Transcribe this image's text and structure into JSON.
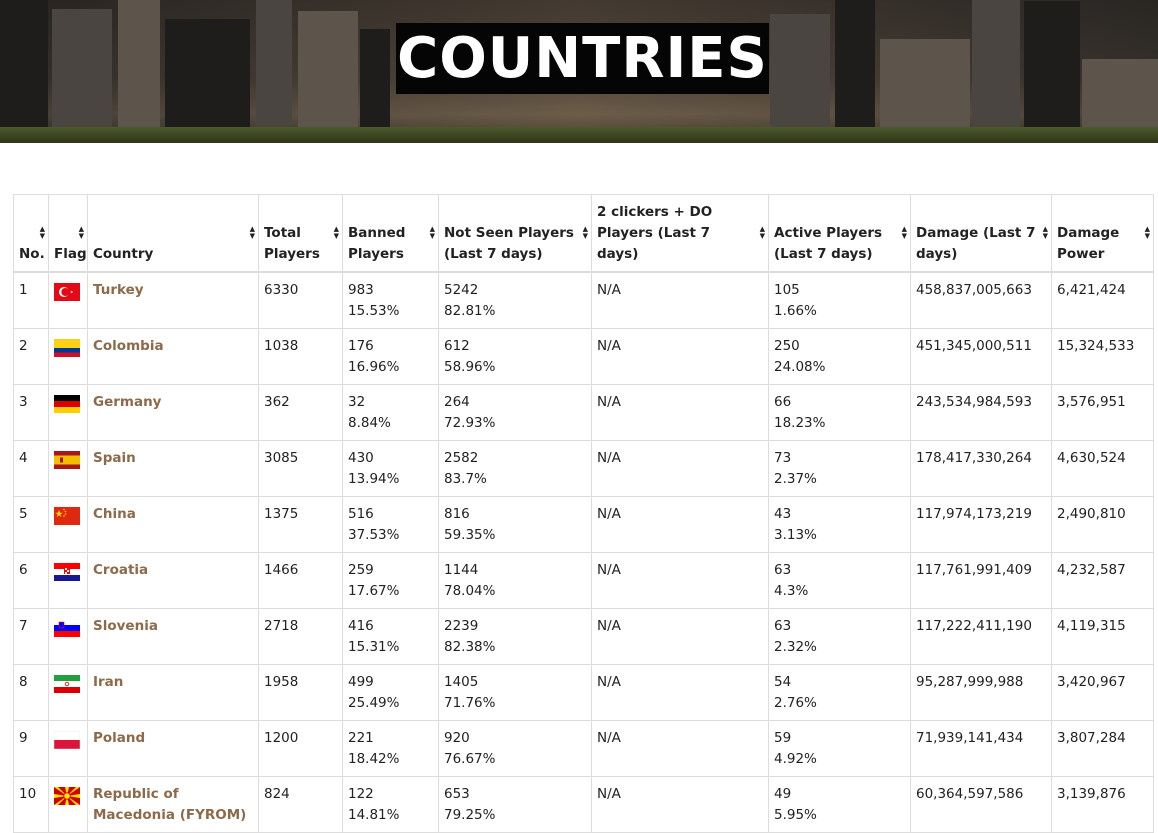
{
  "page": {
    "title": "COUNTRIES"
  },
  "table": {
    "headers": {
      "no": "No.",
      "flag": "Flag",
      "country": "Country",
      "total": "Total Players",
      "banned": "Banned Players",
      "notseen": "Not Seen Players (Last 7 days)",
      "clickers": "2 clickers + DO Players (Last 7 days)",
      "active": "Active Players (Last 7 days)",
      "damage": "Damage (Last 7 days)",
      "power": "Damage Power"
    },
    "rows": [
      {
        "no": "1",
        "country": "Turkey",
        "flag": "turkey-flag-icon",
        "total": "6330",
        "banned": "983",
        "banned_pct": "15.53%",
        "notseen": "5242",
        "notseen_pct": "82.81%",
        "clickers": "N/A",
        "active": "105",
        "active_pct": "1.66%",
        "damage": "458,837,005,663",
        "power": "6,421,424"
      },
      {
        "no": "2",
        "country": "Colombia",
        "flag": "colombia-flag-icon",
        "total": "1038",
        "banned": "176",
        "banned_pct": "16.96%",
        "notseen": "612",
        "notseen_pct": "58.96%",
        "clickers": "N/A",
        "active": "250",
        "active_pct": "24.08%",
        "damage": "451,345,000,511",
        "power": "15,324,533"
      },
      {
        "no": "3",
        "country": "Germany",
        "flag": "germany-flag-icon",
        "total": "362",
        "banned": "32",
        "banned_pct": "8.84%",
        "notseen": "264",
        "notseen_pct": "72.93%",
        "clickers": "N/A",
        "active": "66",
        "active_pct": "18.23%",
        "damage": "243,534,984,593",
        "power": "3,576,951"
      },
      {
        "no": "4",
        "country": "Spain",
        "flag": "spain-flag-icon",
        "total": "3085",
        "banned": "430",
        "banned_pct": "13.94%",
        "notseen": "2582",
        "notseen_pct": "83.7%",
        "clickers": "N/A",
        "active": "73",
        "active_pct": "2.37%",
        "damage": "178,417,330,264",
        "power": "4,630,524"
      },
      {
        "no": "5",
        "country": "China",
        "flag": "china-flag-icon",
        "total": "1375",
        "banned": "516",
        "banned_pct": "37.53%",
        "notseen": "816",
        "notseen_pct": "59.35%",
        "clickers": "N/A",
        "active": "43",
        "active_pct": "3.13%",
        "damage": "117,974,173,219",
        "power": "2,490,810"
      },
      {
        "no": "6",
        "country": "Croatia",
        "flag": "croatia-flag-icon",
        "total": "1466",
        "banned": "259",
        "banned_pct": "17.67%",
        "notseen": "1144",
        "notseen_pct": "78.04%",
        "clickers": "N/A",
        "active": "63",
        "active_pct": "4.3%",
        "damage": "117,761,991,409",
        "power": "4,232,587"
      },
      {
        "no": "7",
        "country": "Slovenia",
        "flag": "slovenia-flag-icon",
        "total": "2718",
        "banned": "416",
        "banned_pct": "15.31%",
        "notseen": "2239",
        "notseen_pct": "82.38%",
        "clickers": "N/A",
        "active": "63",
        "active_pct": "2.32%",
        "damage": "117,222,411,190",
        "power": "4,119,315"
      },
      {
        "no": "8",
        "country": "Iran",
        "flag": "iran-flag-icon",
        "total": "1958",
        "banned": "499",
        "banned_pct": "25.49%",
        "notseen": "1405",
        "notseen_pct": "71.76%",
        "clickers": "N/A",
        "active": "54",
        "active_pct": "2.76%",
        "damage": "95,287,999,988",
        "power": "3,420,967"
      },
      {
        "no": "9",
        "country": "Poland",
        "flag": "poland-flag-icon",
        "total": "1200",
        "banned": "221",
        "banned_pct": "18.42%",
        "notseen": "920",
        "notseen_pct": "76.67%",
        "clickers": "N/A",
        "active": "59",
        "active_pct": "4.92%",
        "damage": "71,939,141,434",
        "power": "3,807,284"
      },
      {
        "no": "10",
        "country": "Republic of Macedonia (FYROM)",
        "flag": "macedonia-flag-icon",
        "total": "824",
        "banned": "122",
        "banned_pct": "14.81%",
        "notseen": "653",
        "notseen_pct": "79.25%",
        "clickers": "N/A",
        "active": "49",
        "active_pct": "5.95%",
        "damage": "60,364,597,586",
        "power": "3,139,876"
      }
    ]
  }
}
